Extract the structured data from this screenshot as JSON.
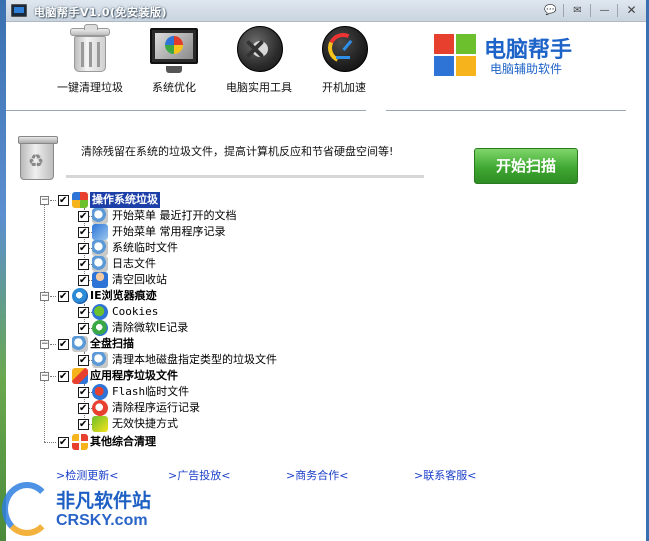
{
  "window": {
    "title": "电脑帮手V1.0(免安装版)",
    "titlebar_buttons": [
      "feedback-icon",
      "skin-icon",
      "minimize-icon",
      "close-icon"
    ]
  },
  "toolbar": {
    "items": [
      {
        "label": "一键清理垃圾",
        "icon": "trash-can-icon"
      },
      {
        "label": "系统优化",
        "icon": "monitor-optimize-icon"
      },
      {
        "label": "电脑实用工具",
        "icon": "tools-disc-icon"
      },
      {
        "label": "开机加速",
        "icon": "speed-gauge-icon"
      }
    ]
  },
  "logo": {
    "title": "电脑帮手",
    "subtitle": "电脑辅助软件",
    "colors": [
      "#e8402f",
      "#6cbf2d",
      "#2d74d6",
      "#f6b31c"
    ]
  },
  "main": {
    "description": "清除残留在系统的垃圾文件，提高计算机反应和节省硬盘空间等!",
    "scan_button": "开始扫描"
  },
  "tree": {
    "groups": [
      {
        "label": "操作系统垃圾",
        "checked": true,
        "selected": true,
        "children": [
          {
            "label": "开始菜单 最近打开的文档",
            "checked": true
          },
          {
            "label": "开始菜单 常用程序记录",
            "checked": true
          },
          {
            "label": "系统临时文件",
            "checked": true
          },
          {
            "label": "日志文件",
            "checked": true
          },
          {
            "label": "清空回收站",
            "checked": true
          }
        ]
      },
      {
        "label": "IE浏览器痕迹",
        "checked": true,
        "children": [
          {
            "label": "Cookies",
            "checked": true
          },
          {
            "label": "清除微软IE记录",
            "checked": true
          }
        ]
      },
      {
        "label": "全盘扫描",
        "checked": true,
        "children": [
          {
            "label": "清理本地磁盘指定类型的垃圾文件",
            "checked": true
          }
        ]
      },
      {
        "label": "应用程序垃圾文件",
        "checked": true,
        "children": [
          {
            "label": "Flash临时文件",
            "checked": true
          },
          {
            "label": "清除程序运行记录",
            "checked": true
          },
          {
            "label": "无效快捷方式",
            "checked": true
          }
        ]
      },
      {
        "label": "其他综合清理",
        "checked": true,
        "children": []
      }
    ]
  },
  "links": [
    ">检测更新<",
    ">广告投放<",
    ">商务合作<",
    ">联系客服<"
  ],
  "watermark": {
    "title": "非凡软件站",
    "subtitle": "CRSKY.com"
  }
}
